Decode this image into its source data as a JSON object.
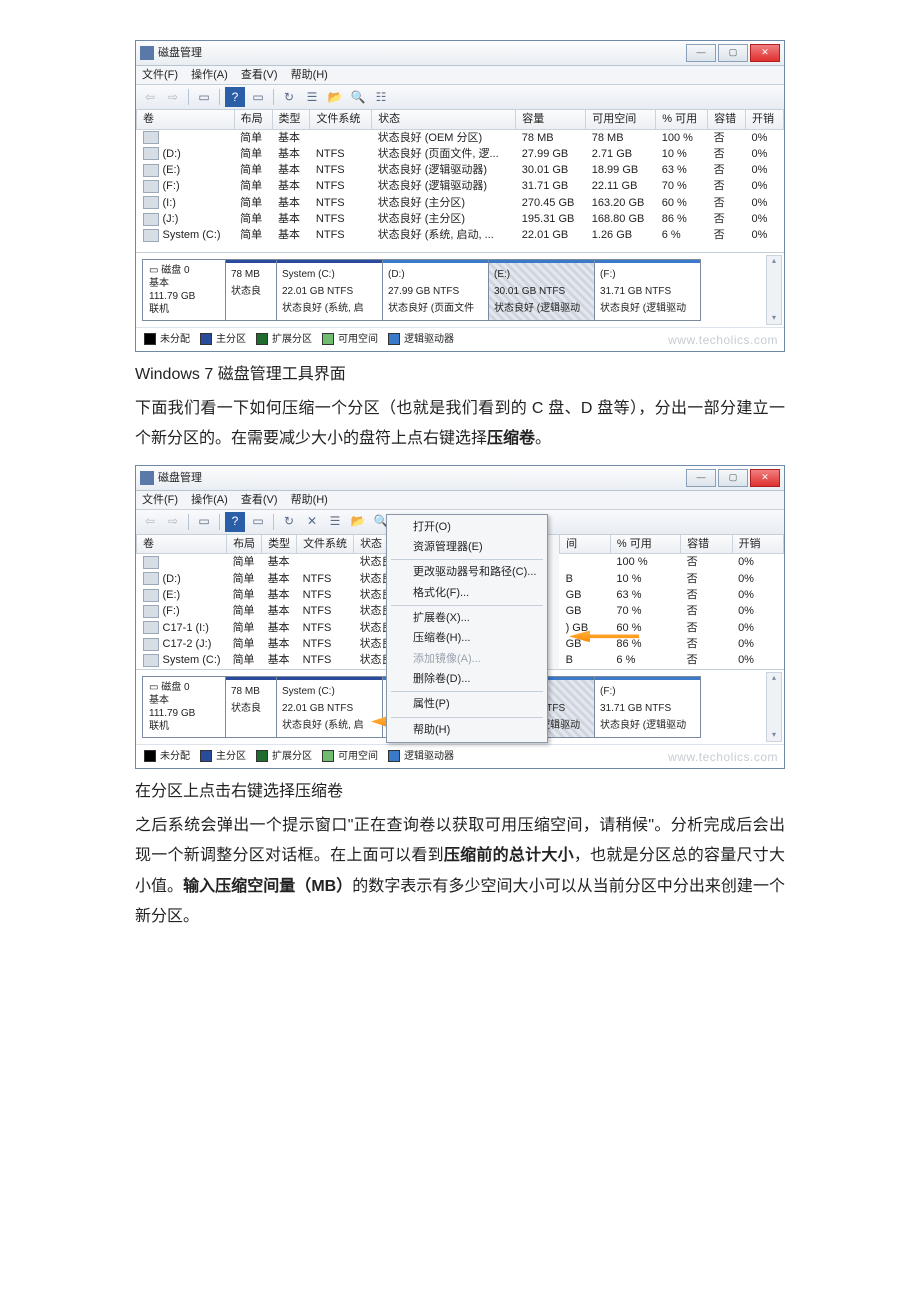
{
  "window": {
    "title": "磁盘管理",
    "menus": [
      "文件(F)",
      "操作(A)",
      "查看(V)",
      "帮助(H)"
    ],
    "toolbar_icons": [
      "back",
      "forward",
      "up",
      "help",
      "props",
      "refresh",
      "delete",
      "open",
      "find",
      "list"
    ],
    "columns": [
      "卷",
      "布局",
      "类型",
      "文件系统",
      "状态",
      "容量",
      "可用空间",
      "% 可用",
      "容错",
      "开销"
    ],
    "rows": [
      {
        "vol": "",
        "layout": "简单",
        "type": "基本",
        "fs": "",
        "status": "状态良好 (OEM 分区)",
        "cap": "78 MB",
        "free": "78 MB",
        "pct": "100 %",
        "ft": "否",
        "oh": "0%"
      },
      {
        "vol": "(D:)",
        "layout": "简单",
        "type": "基本",
        "fs": "NTFS",
        "status": "状态良好 (页面文件, 逻...",
        "cap": "27.99 GB",
        "free": "2.71 GB",
        "pct": "10 %",
        "ft": "否",
        "oh": "0%"
      },
      {
        "vol": "(E:)",
        "layout": "简单",
        "type": "基本",
        "fs": "NTFS",
        "status": "状态良好 (逻辑驱动器)",
        "cap": "30.01 GB",
        "free": "18.99 GB",
        "pct": "63 %",
        "ft": "否",
        "oh": "0%"
      },
      {
        "vol": "(F:)",
        "layout": "简单",
        "type": "基本",
        "fs": "NTFS",
        "status": "状态良好 (逻辑驱动器)",
        "cap": "31.71 GB",
        "free": "22.11 GB",
        "pct": "70 %",
        "ft": "否",
        "oh": "0%"
      },
      {
        "vol": "(I:)",
        "layout": "简单",
        "type": "基本",
        "fs": "NTFS",
        "status": "状态良好 (主分区)",
        "cap": "270.45 GB",
        "free": "163.20 GB",
        "pct": "60 %",
        "ft": "否",
        "oh": "0%"
      },
      {
        "vol": "(J:)",
        "layout": "简单",
        "type": "基本",
        "fs": "NTFS",
        "status": "状态良好 (主分区)",
        "cap": "195.31 GB",
        "free": "168.80 GB",
        "pct": "86 %",
        "ft": "否",
        "oh": "0%"
      },
      {
        "vol": "System (C:)",
        "layout": "简单",
        "type": "基本",
        "fs": "NTFS",
        "status": "状态良好 (系统, 启动, ...",
        "cap": "22.01 GB",
        "free": "1.26 GB",
        "pct": "6 %",
        "ft": "否",
        "oh": "0%"
      }
    ],
    "disk": {
      "label": "磁盘 0",
      "type": "基本",
      "size": "111.79 GB",
      "state": "联机",
      "reserved": {
        "size": "78 MB",
        "status": "状态良"
      },
      "partitions": [
        {
          "name": "System  (C:)",
          "size": "22.01 GB NTFS",
          "status": "状态良好 (系统, 启"
        },
        {
          "name": "(D:)",
          "size": "27.99 GB NTFS",
          "status": "状态良好 (页面文件"
        },
        {
          "name": "(E:)",
          "size": "30.01 GB NTFS",
          "status": "状态良好 (逻辑驱动"
        },
        {
          "name": "(F:)",
          "size": "31.71 GB NTFS",
          "status": "状态良好 (逻辑驱动"
        }
      ]
    },
    "legend": [
      "未分配",
      "主分区",
      "扩展分区",
      "可用空间",
      "逻辑驱动器"
    ],
    "watermark": "www.techolics.com"
  },
  "caption1": "Windows 7 磁盘管理工具界面",
  "para1_a": "下面我们看一下如何压缩一个分区（也就是我们看到的 C 盘、D 盘等），分出一部分建立一个新分区的。在需要减少大小的盘符上点右键选择",
  "para1_b": "压缩卷",
  "para1_c": "。",
  "window2": {
    "cols_short": [
      "卷",
      "布局",
      "类型",
      "文件系统",
      "状态"
    ],
    "cols_right": [
      "间",
      "% 可用",
      "容错",
      "开销"
    ],
    "rows": [
      {
        "vol": "",
        "layout": "简单",
        "type": "基本",
        "fs": "",
        "status": "状态良",
        "r1": "",
        "pct": "100 %",
        "ft": "否",
        "oh": "0%"
      },
      {
        "vol": "(D:)",
        "layout": "简单",
        "type": "基本",
        "fs": "NTFS",
        "status": "状态良",
        "r1": "B",
        "pct": "10 %",
        "ft": "否",
        "oh": "0%"
      },
      {
        "vol": "(E:)",
        "layout": "简单",
        "type": "基本",
        "fs": "NTFS",
        "status": "状态良",
        "r1": "GB",
        "pct": "63 %",
        "ft": "否",
        "oh": "0%"
      },
      {
        "vol": "(F:)",
        "layout": "简单",
        "type": "基本",
        "fs": "NTFS",
        "status": "状态良",
        "r1": "GB",
        "pct": "70 %",
        "ft": "否",
        "oh": "0%"
      },
      {
        "vol": "C17-1 (I:)",
        "layout": "简单",
        "type": "基本",
        "fs": "NTFS",
        "status": "状态良",
        "r1": ") GB",
        "pct": "60 %",
        "ft": "否",
        "oh": "0%"
      },
      {
        "vol": "C17-2 (J:)",
        "layout": "简单",
        "type": "基本",
        "fs": "NTFS",
        "status": "状态良",
        "r1": "GB",
        "pct": "86 %",
        "ft": "否",
        "oh": "0%"
      },
      {
        "vol": "System (C:)",
        "layout": "简单",
        "type": "基本",
        "fs": "NTFS",
        "status": "状态良",
        "r1": "B",
        "pct": "6 %",
        "ft": "否",
        "oh": "0%"
      }
    ],
    "context_menu": [
      {
        "label": "打开(O)",
        "enabled": true
      },
      {
        "label": "资源管理器(E)",
        "enabled": true
      },
      {
        "sep": true
      },
      {
        "label": "更改驱动器号和路径(C)...",
        "enabled": true
      },
      {
        "label": "格式化(F)...",
        "enabled": true
      },
      {
        "sep": true
      },
      {
        "label": "扩展卷(X)...",
        "enabled": true
      },
      {
        "label": "压缩卷(H)...",
        "enabled": true,
        "highlight": true
      },
      {
        "label": "添加镜像(A)...",
        "enabled": false
      },
      {
        "label": "删除卷(D)...",
        "enabled": true
      },
      {
        "sep": true
      },
      {
        "label": "属性(P)",
        "enabled": true
      },
      {
        "sep": true
      },
      {
        "label": "帮助(H)",
        "enabled": true
      }
    ]
  },
  "caption2": "在分区上点击右键选择压缩卷",
  "para2_a": "之后系统会弹出一个提示窗口\"正在查询卷以获取可用压缩空间，请稍候\"。分析完成后会出现一个新调整分区对话框。在上面可以看到",
  "para2_b": "压缩前的总计大小",
  "para2_c": "，也就是分区总的容量尺寸大小值。",
  "para2_d": "输入压缩空间量（MB）",
  "para2_e": "的数字表示有多少空间大小可以从当前分区中分出来创建一个新分区。"
}
